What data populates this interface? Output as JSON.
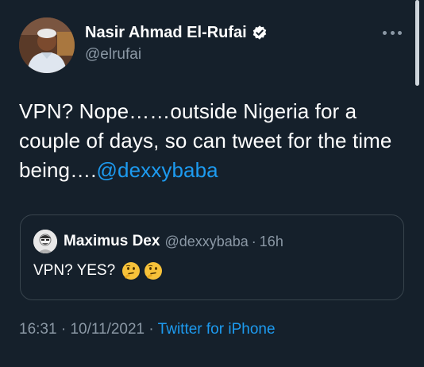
{
  "tweet": {
    "author": {
      "display_name": "Nasir Ahmad El-Rufai",
      "handle": "@elrufai",
      "verified": true
    },
    "text_main": "VPN? Nope……outside Nigeria for a couple of days, so can tweet for the time being….",
    "text_mention": "@dexxybaba",
    "quote": {
      "display_name": "Maximus Dex",
      "handle": "@dexxybaba",
      "separator": "·",
      "time_ago": "16h",
      "text": "VPN? YES?",
      "emojis": [
        "thinking-face-emoji",
        "thinking-face-emoji"
      ]
    },
    "meta": {
      "time": "16:31",
      "separator": "·",
      "date": "10/11/2021",
      "separator2": "·",
      "source": "Twitter for iPhone"
    }
  },
  "colors": {
    "background": "#15202b",
    "text": "#ffffff",
    "secondary_text": "#8b98a5",
    "link": "#1d9bf0",
    "border": "#38444d"
  },
  "icons": [
    "verified-badge-icon",
    "more-options-icon"
  ]
}
